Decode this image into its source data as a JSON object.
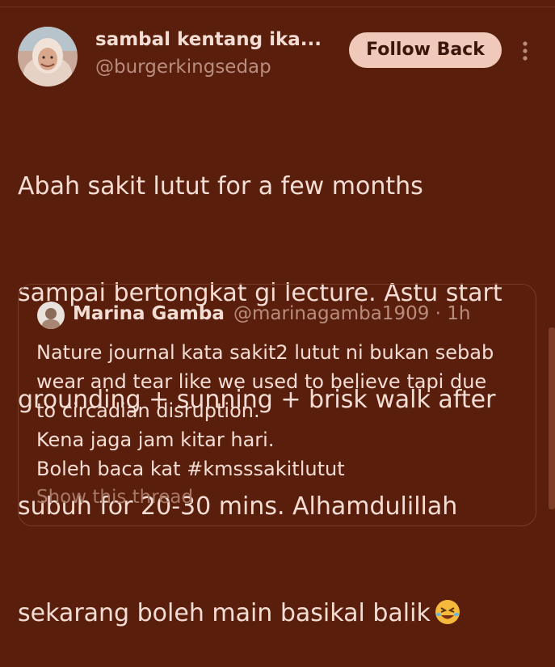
{
  "author": {
    "display_name": "sambal kentang ika...",
    "handle": "@burgerkingsedap"
  },
  "follow_button": {
    "label": "Follow Back"
  },
  "tweet": {
    "lines": [
      "Abah sakit lutut for a few months",
      "sampai bertongkat gi lecture. Astu start",
      "grounding + sunning + brisk walk after",
      "subuh for 20-30 mins. Alhamdulillah",
      "sekarang boleh main basikal balik"
    ],
    "emoji": "rolling-on-the-floor-laughing"
  },
  "quoted_tweet": {
    "display_name": "Marina Gamba",
    "handle_time": "@marinagamba1909 · 1h",
    "lines": [
      "Nature journal kata sakit2 lutut ni bukan sebab",
      "wear and tear like we used to believe tapi due",
      "to circadian disruption.",
      "Kena jaga jam kitar hari.",
      "Boleh baca kat #kmsssakitlutut"
    ],
    "show_thread": "Show this thread"
  },
  "icons": {
    "more": "more-vertical-icon",
    "emoji": "rofl-emoji-icon"
  },
  "colors": {
    "background": "#5a1e0c",
    "button": "#f0c9ba",
    "text": "#f3ddd4",
    "secondary": "#b98d7e",
    "link": "#a87866"
  }
}
